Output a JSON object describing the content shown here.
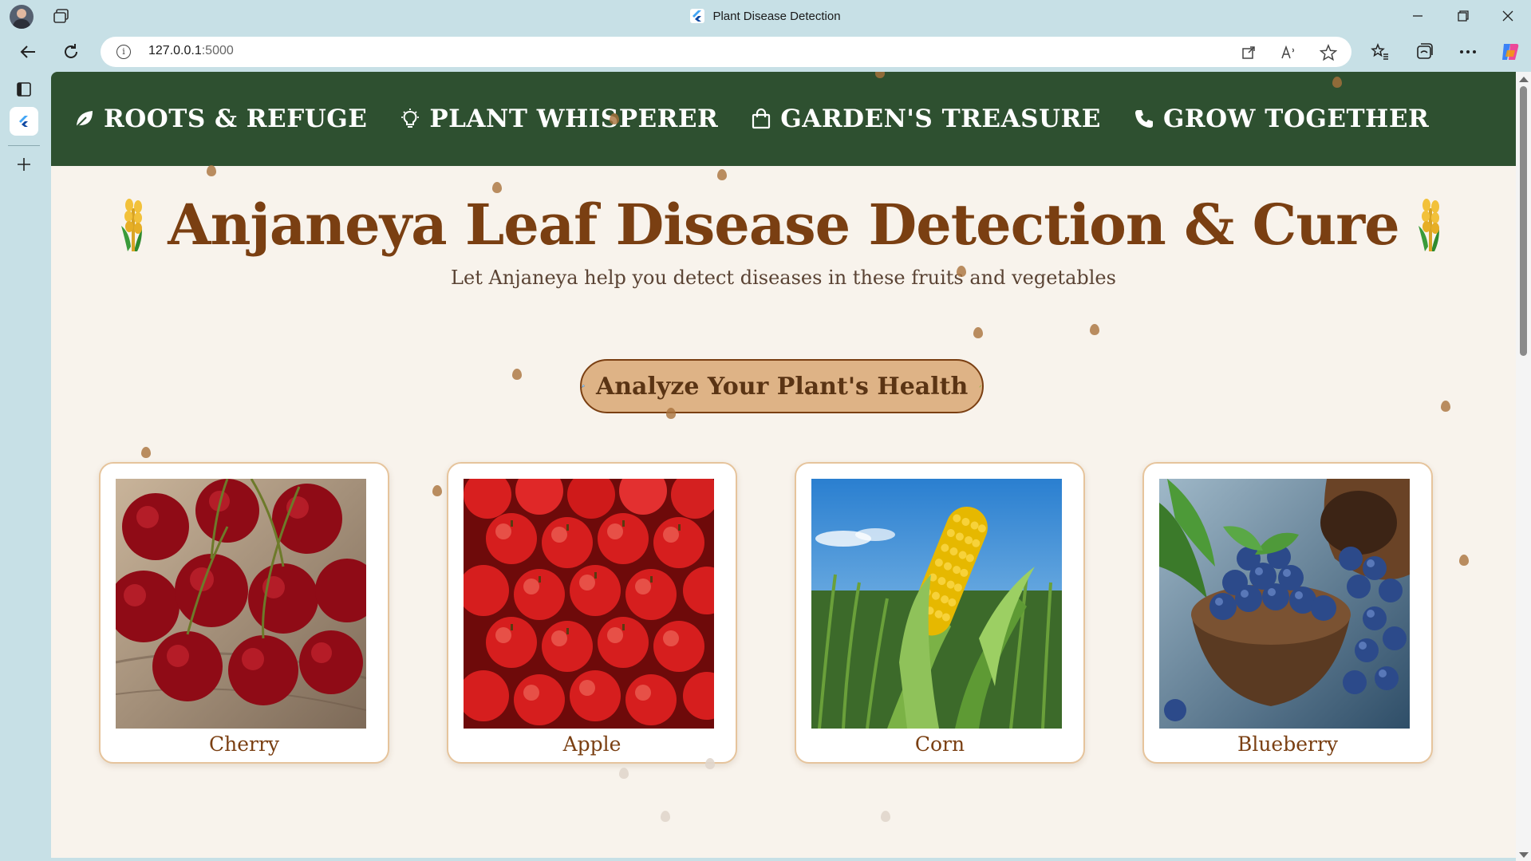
{
  "browser": {
    "tab_title": "Plant Disease Detection",
    "url_host": "127.0.0.1",
    "url_port": ":5000"
  },
  "nav": {
    "items": [
      {
        "label": "ROOTS & REFUGE",
        "icon": "leaf-icon"
      },
      {
        "label": "PLANT WHISPERER",
        "icon": "lightbulb-icon"
      },
      {
        "label": "GARDEN'S TREASURE",
        "icon": "shopping-bag-icon"
      },
      {
        "label": "GROW TOGETHER",
        "icon": "phone-icon"
      }
    ]
  },
  "hero": {
    "title": "Anjaneya Leaf Disease Detection & Cure",
    "subtitle": "Let Anjaneya help you detect diseases in these fruits and vegetables",
    "title_icon": "wheat-icon"
  },
  "cta": {
    "label": "Analyze Your Plant's Health",
    "left_icon": "magnifier-icon",
    "right_icon": "herb-icon"
  },
  "cards": [
    {
      "label": "Cherry",
      "image": "cherries-image"
    },
    {
      "label": "Apple",
      "image": "apples-image"
    },
    {
      "label": "Corn",
      "image": "corn-image"
    },
    {
      "label": "Blueberry",
      "image": "blueberries-image"
    }
  ],
  "colors": {
    "nav_bg": "#2e5030",
    "title_brown": "#7a3f12",
    "page_bg": "#f8f3ec",
    "cta_bg": "#deb386",
    "card_border": "#e6c49c"
  }
}
